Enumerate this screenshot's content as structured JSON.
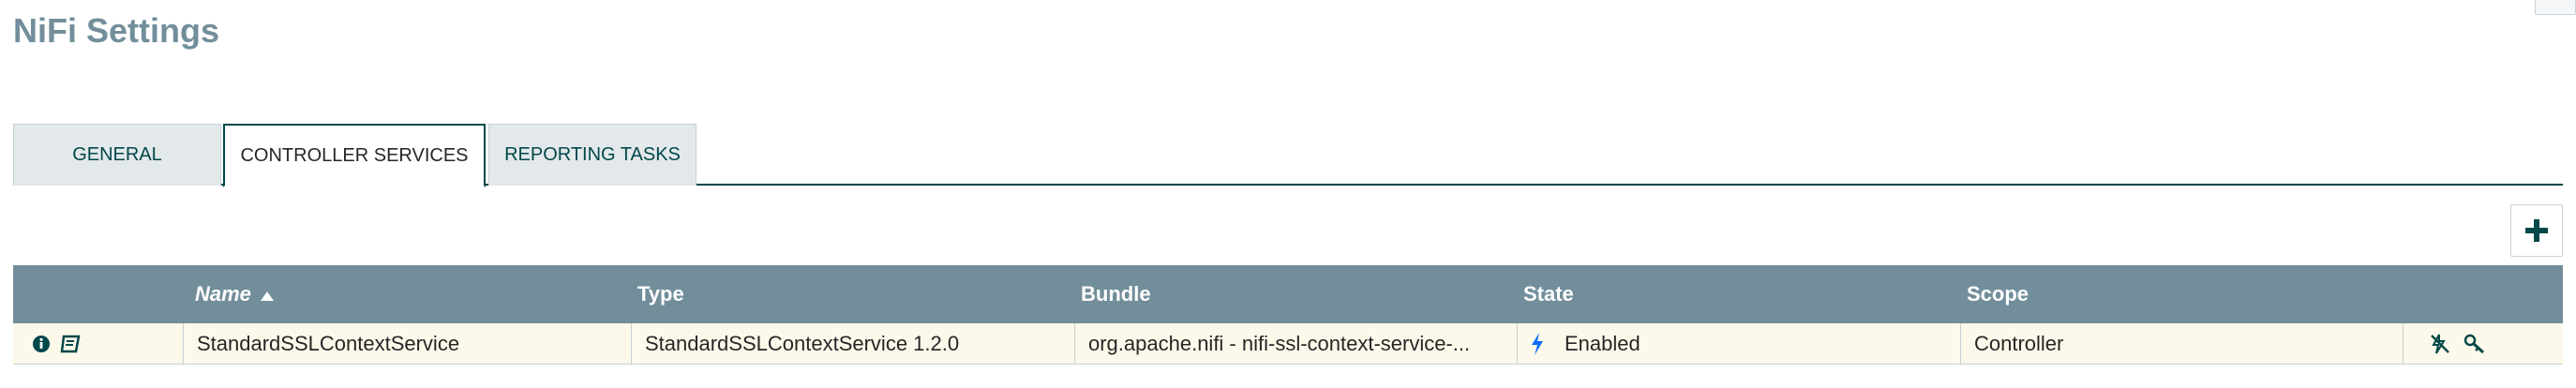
{
  "page": {
    "title": "NiFi Settings"
  },
  "tabs": [
    {
      "label": "GENERAL",
      "active": false
    },
    {
      "label": "CONTROLLER SERVICES",
      "active": true
    },
    {
      "label": "REPORTING TASKS",
      "active": false
    }
  ],
  "toolbar": {
    "add_icon": "plus-icon"
  },
  "table": {
    "columns": [
      "Name",
      "Type",
      "Bundle",
      "State",
      "Scope"
    ],
    "sort": {
      "column": "Name",
      "direction": "ascending"
    },
    "rows": [
      {
        "name": "StandardSSLContextService",
        "type": "StandardSSLContextService 1.2.0",
        "bundle": "org.apache.nifi - nifi-ssl-context-service-...",
        "state": "Enabled",
        "scope": "Controller",
        "row_icons": [
          "info-icon",
          "usage-doc-icon"
        ],
        "action_icons": [
          "disable-icon",
          "remove-icon"
        ]
      }
    ]
  },
  "colors": {
    "header_bg": "#728e9b",
    "title": "#728e9b",
    "tab_border": "#004849",
    "row_bg": "#fdf9ea",
    "enabled_icon": "#0d6efd"
  }
}
